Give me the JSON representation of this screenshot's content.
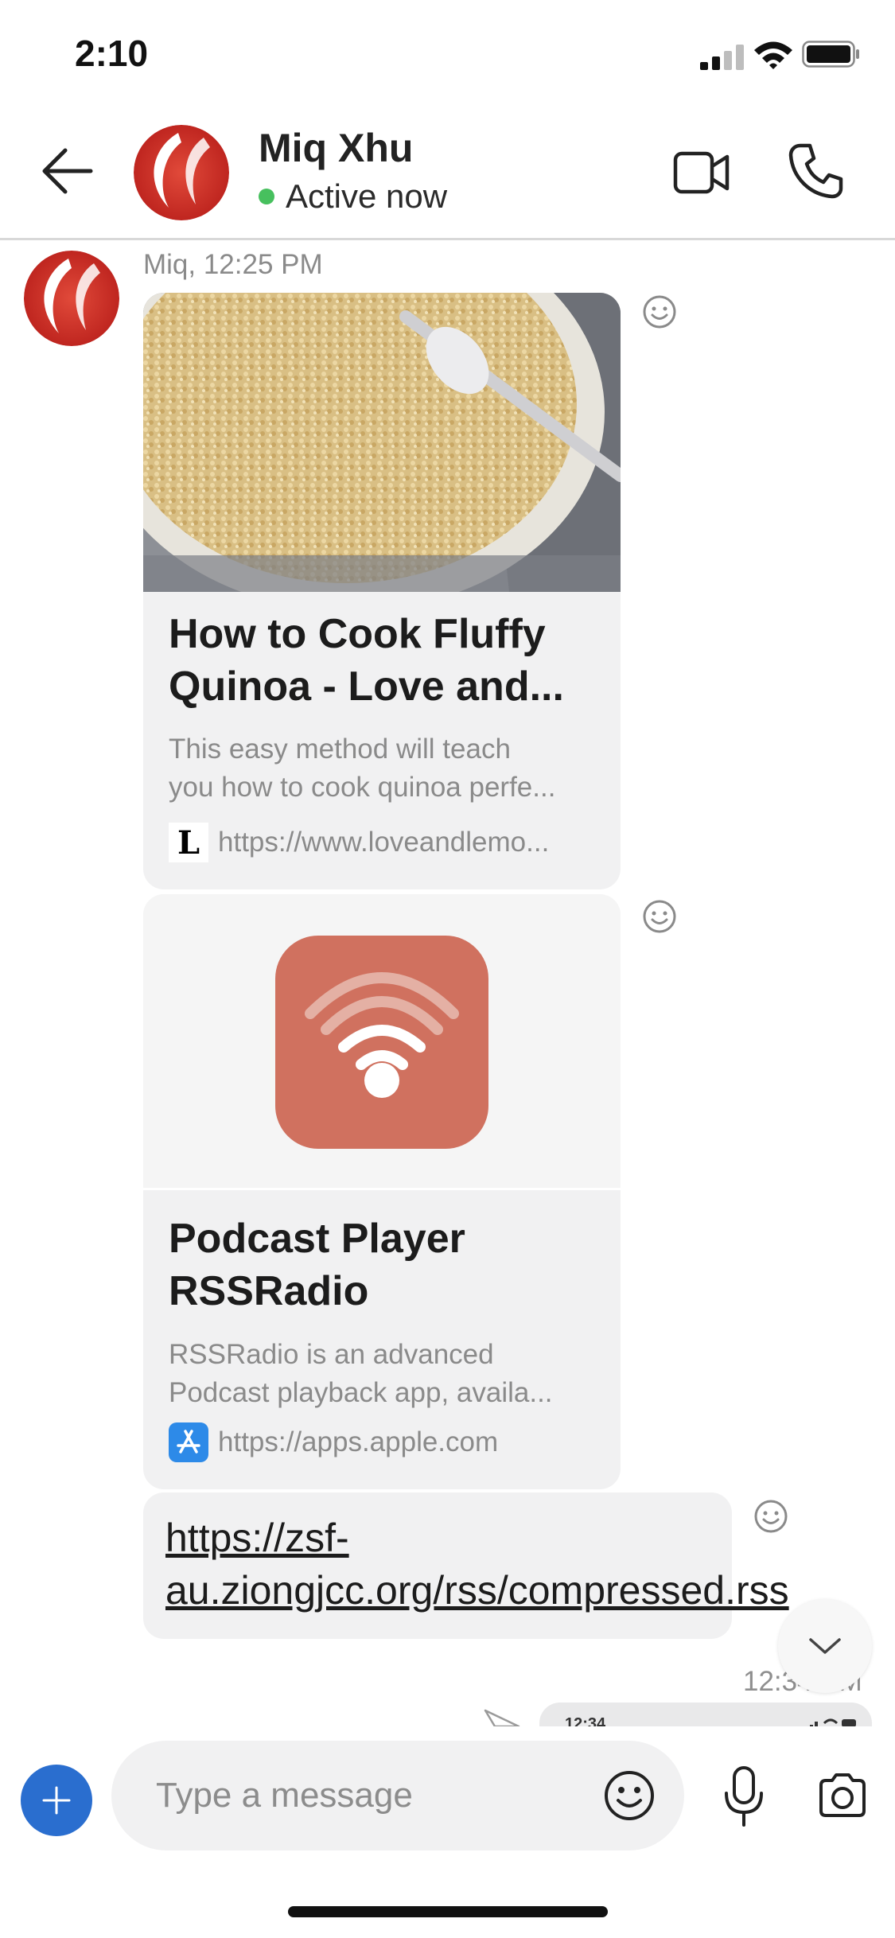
{
  "status_bar": {
    "time": "2:10"
  },
  "header": {
    "contact_name": "Miq Xhu",
    "presence": "Active now",
    "presence_color": "#47c05e"
  },
  "conversation": {
    "sender_meta": "Miq, 12:25 PM",
    "cards": [
      {
        "title": "How to Cook Fluffy Quinoa - Love and...",
        "description": "This easy method will teach\nyou how to cook quinoa perfe...",
        "url": "https://www.loveandlemo...",
        "favicon_letter": "L"
      },
      {
        "title": "Podcast Player RSSRadio",
        "description": "RSSRadio is an advanced\nPodcast playback app, availa...",
        "url": "https://apps.apple.com",
        "app_icon_color": "#d0715f"
      }
    ],
    "link_message": "https://zsf-au.ziongjcc.org/rss/compressed.rss",
    "sent_time": "12:34 PM",
    "sent_preview_time": "12:34"
  },
  "composer": {
    "placeholder": "Type a message",
    "accent_color": "#2a6ecf"
  },
  "icons": [
    "back-arrow-icon",
    "video-call-icon",
    "phone-icon",
    "emoji-react-icon",
    "chevron-down-icon",
    "plus-icon",
    "emoji-icon",
    "microphone-icon",
    "camera-icon",
    "sent-icon"
  ]
}
